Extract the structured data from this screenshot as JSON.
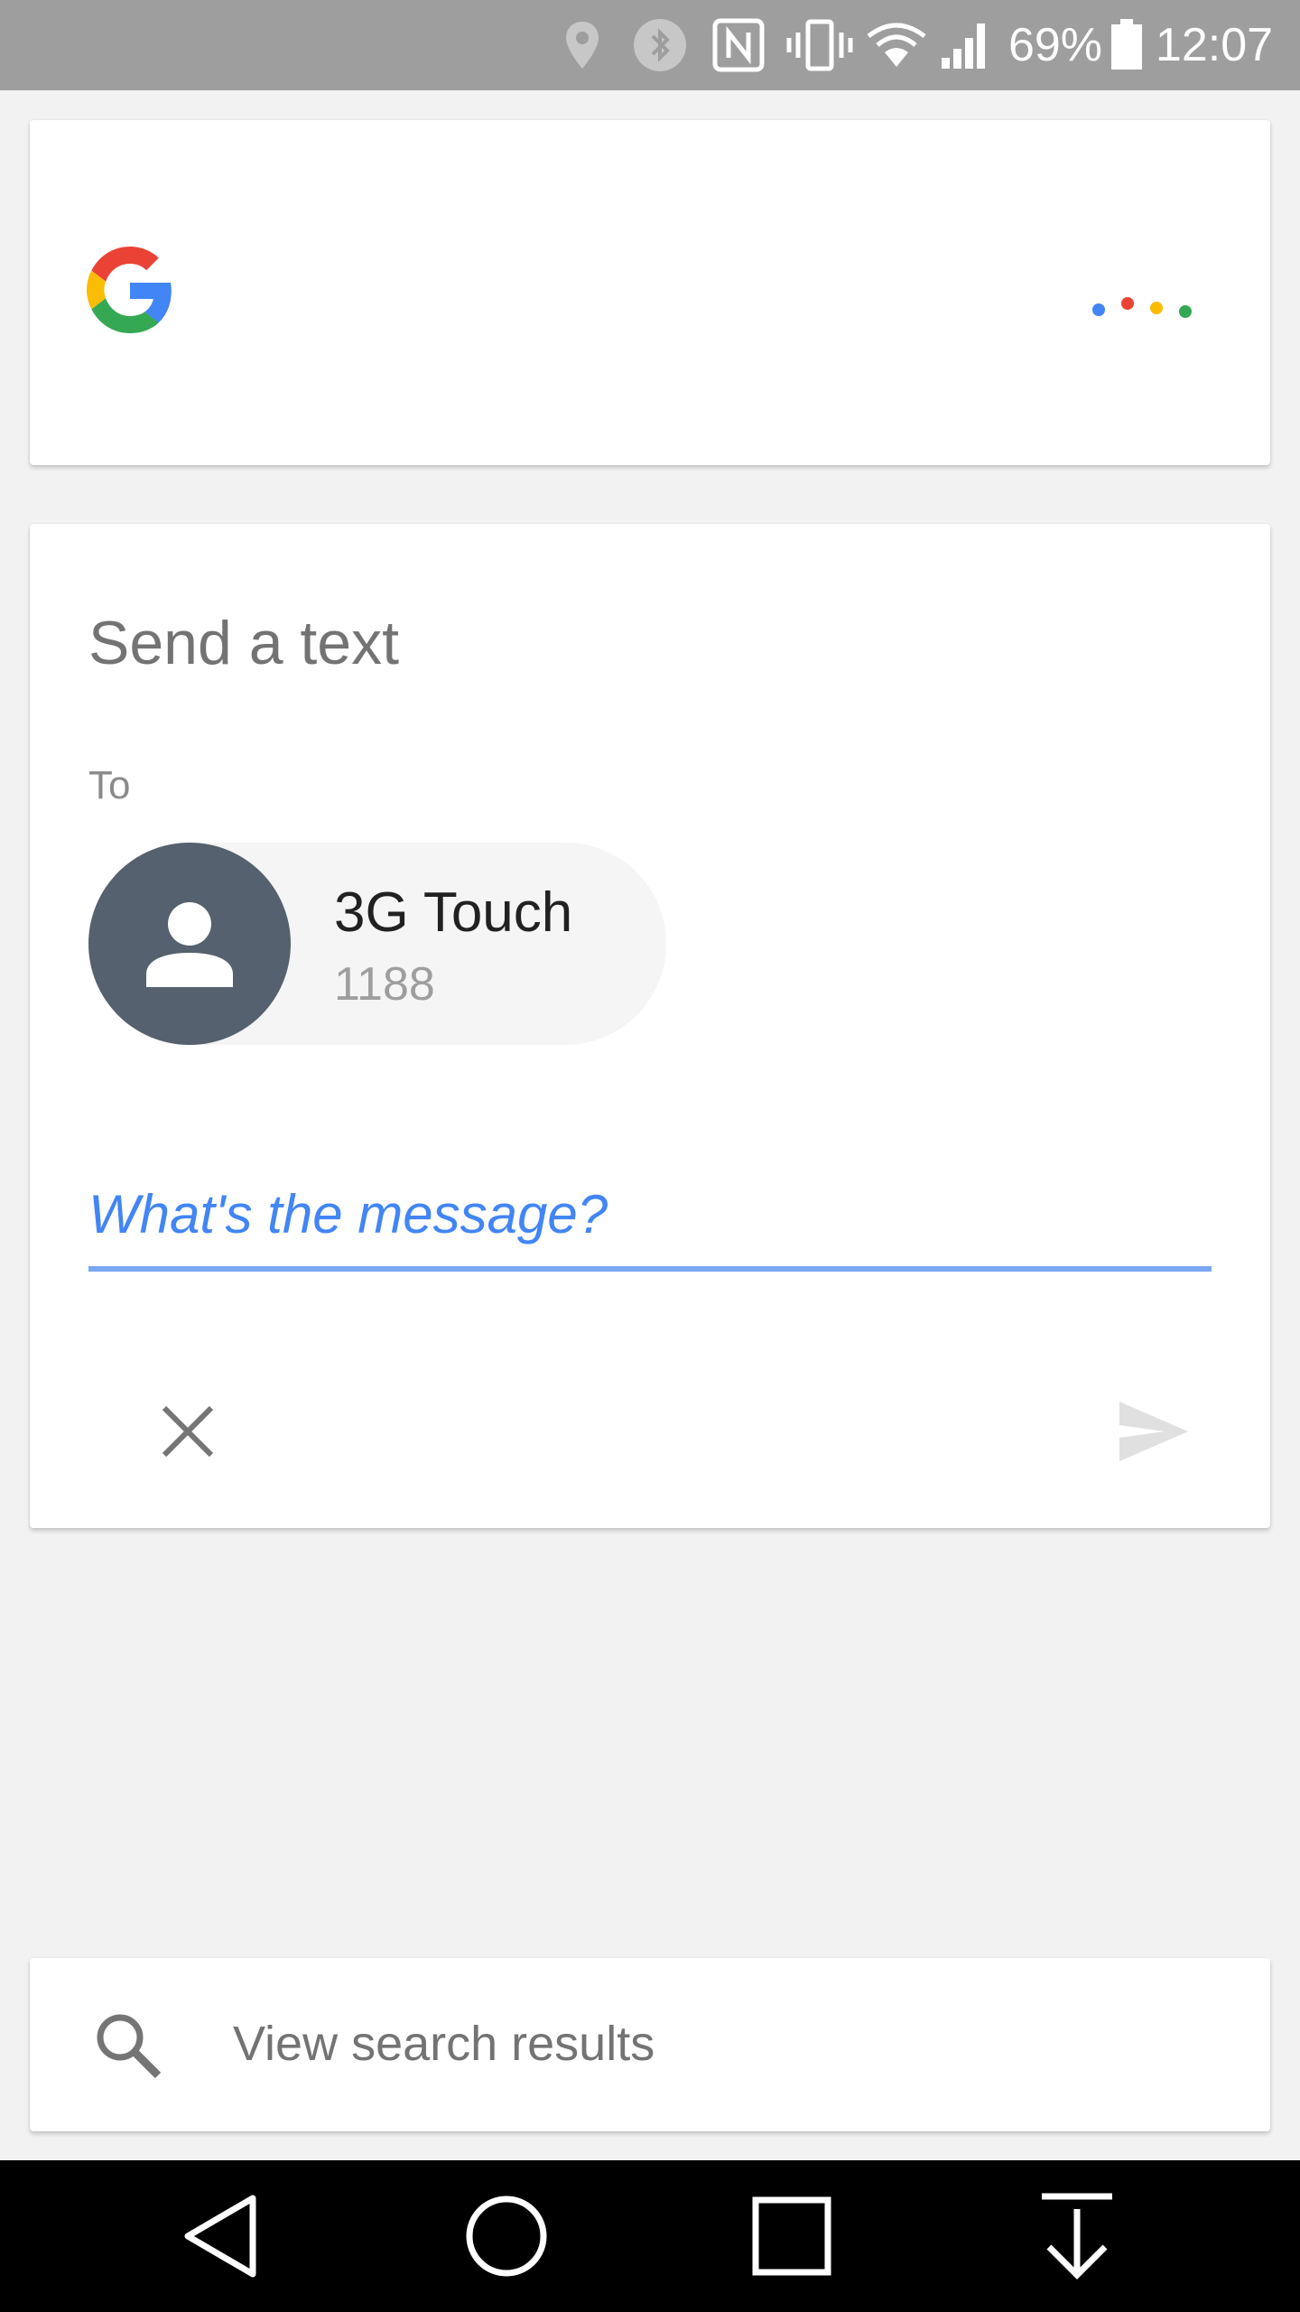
{
  "status_bar": {
    "battery_percent": "69%",
    "time": "12:07",
    "icons": [
      "location-icon",
      "bluetooth-icon",
      "nfc-icon",
      "vibrate-icon",
      "wifi-icon",
      "signal-icon",
      "battery-icon"
    ]
  },
  "assistant_card": {
    "logo": "google-g-logo",
    "dot_colors": [
      "#4285f4",
      "#ea4335",
      "#fbbc05",
      "#34a853"
    ]
  },
  "message_card": {
    "title": "Send a text",
    "to_label": "To",
    "contact": {
      "name": "3G Touch",
      "number": "1188"
    },
    "message_placeholder": "What's the message?",
    "actions": [
      "close-icon",
      "send-icon"
    ]
  },
  "search_card": {
    "label": "View search results"
  },
  "nav_bar": {
    "buttons": [
      "back-icon",
      "home-icon",
      "recents-icon",
      "notification-pull-icon"
    ]
  },
  "colors": {
    "accent_blue": "#4285f4",
    "avatar_bg": "#56616f",
    "status_bar_bg": "#9e9e9e",
    "nav_bar_bg": "#000000"
  }
}
